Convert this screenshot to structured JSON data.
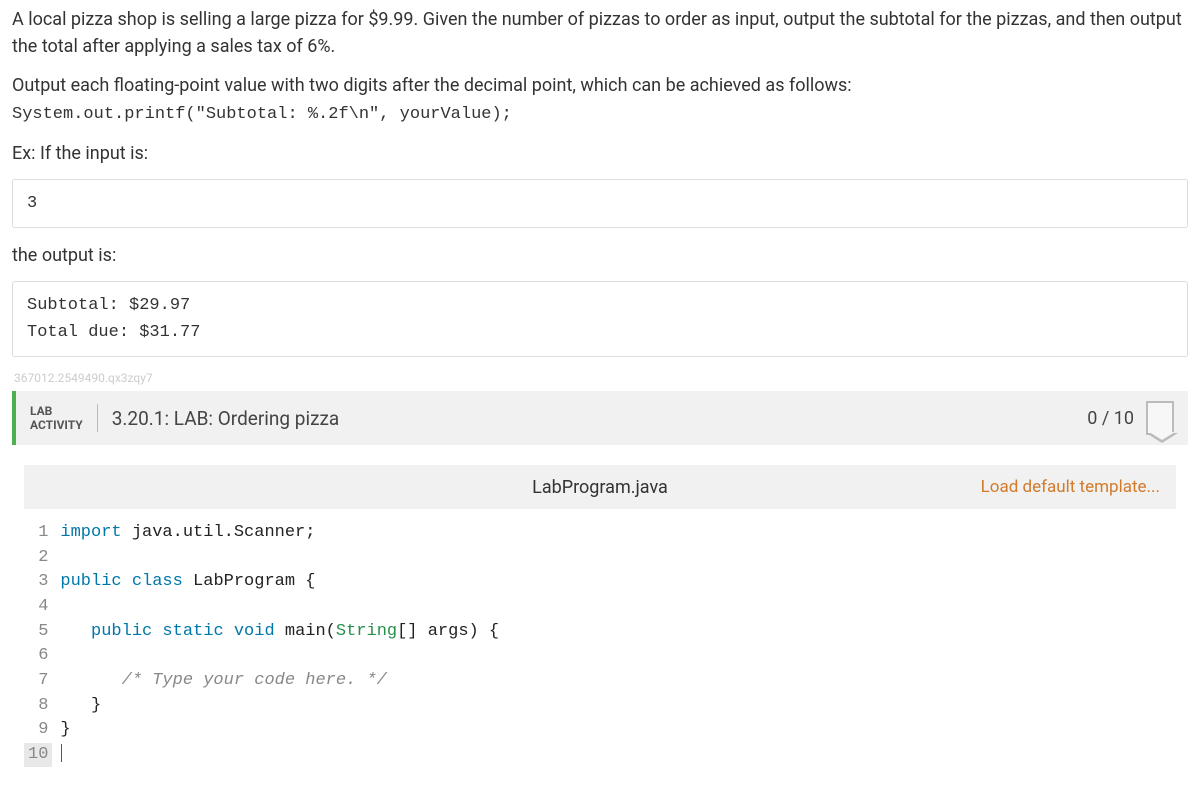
{
  "problem": {
    "p1": "A local pizza shop is selling a large pizza for $9.99. Given the number of pizzas to order as input, output the subtotal for the pizzas, and then output the total after applying a sales tax of 6%.",
    "p2": "Output each floating-point value with two digits after the decimal point, which can be achieved as follows:",
    "code_hint": "System.out.printf(\"Subtotal: %.2f\\n\", yourValue);",
    "ex_label": "Ex: If the input is:",
    "input_sample": "3",
    "output_label": "the output is:",
    "output_sample": "Subtotal: $29.97\nTotal due: $31.77"
  },
  "watermark": "367012.2549490.qx3zqy7",
  "lab": {
    "badge_line1": "LAB",
    "badge_line2": "ACTIVITY",
    "title": "3.20.1: LAB: Ordering pizza",
    "score": "0 / 10"
  },
  "editor": {
    "filename": "LabProgram.java",
    "load_template": "Load default template...",
    "line_numbers": [
      "1",
      "2",
      "3",
      "4",
      "5",
      "6",
      "7",
      "8",
      "9",
      "10"
    ],
    "lines": {
      "l1_a": "import",
      "l1_b": " java.util.Scanner;",
      "l3_a": "public",
      "l3_b": " class",
      "l3_c": " LabProgram {",
      "l5_a": "   public",
      "l5_b": " static",
      "l5_c": " void",
      "l5_d": " main(",
      "l5_e": "String",
      "l5_f": "[] args) {",
      "l7": "      /* Type your code here. */",
      "l8": "   }",
      "l9": "}"
    }
  }
}
